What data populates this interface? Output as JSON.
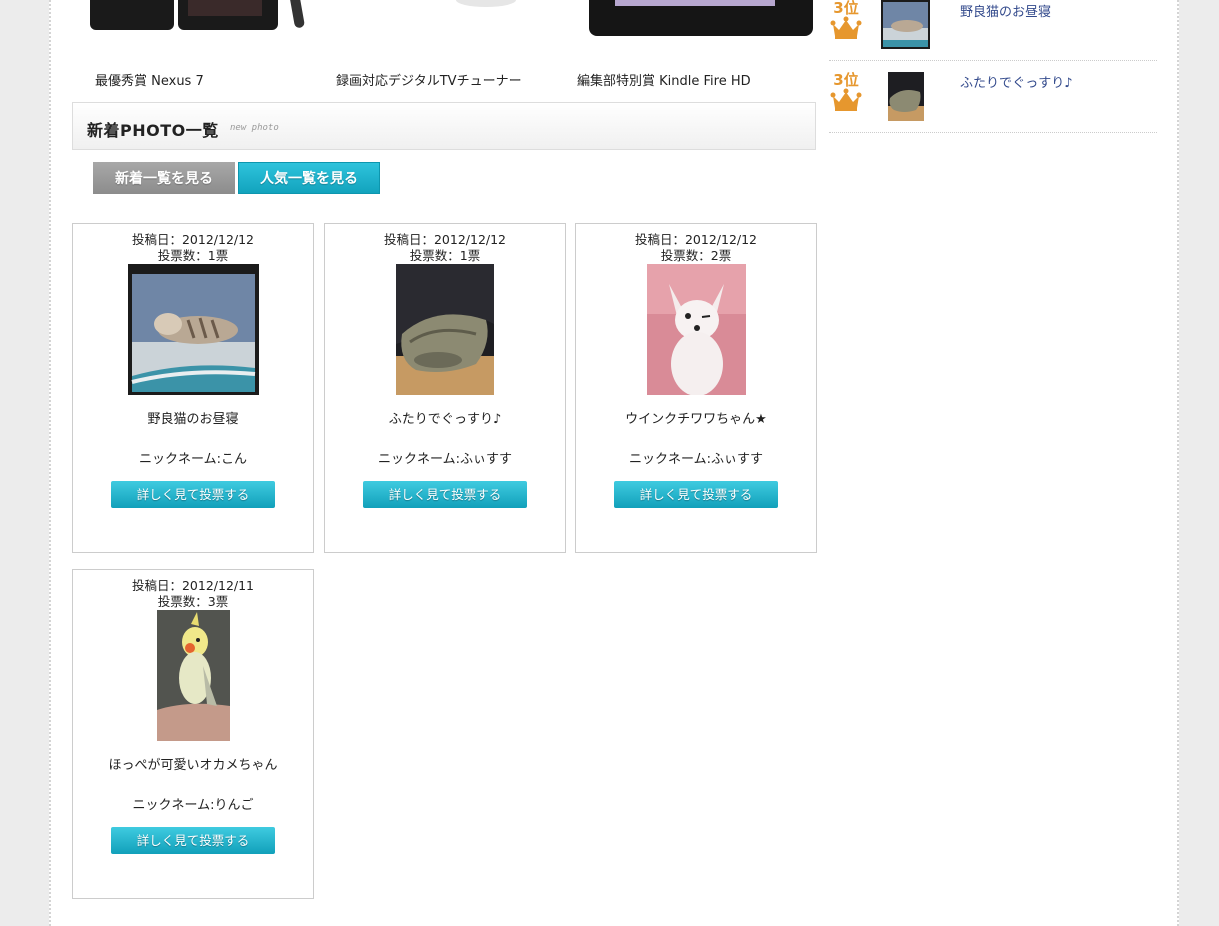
{
  "prizes": [
    {
      "caption": "最優秀賞 Nexus 7"
    },
    {
      "caption": "録画対応デジタルTVチューナー"
    },
    {
      "caption": "編集部特別賞 Kindle Fire HD"
    }
  ],
  "section": {
    "title": "新着PHOTO一覧",
    "subtitle": "new photo"
  },
  "tabs": {
    "new_label": "新着一覧を見る",
    "popular_label": "人気一覧を見る"
  },
  "photos": [
    {
      "date": "投稿日：2012/12/12",
      "votes": "投票数：1票",
      "title": "野良猫のお昼寝",
      "nickname": "ニックネーム:こん",
      "button": "詳しく見て投票する"
    },
    {
      "date": "投稿日：2012/12/12",
      "votes": "投票数：1票",
      "title": "ふたりでぐっすり♪",
      "nickname": "ニックネーム:ふぃすす",
      "button": "詳しく見て投票する"
    },
    {
      "date": "投稿日：2012/12/12",
      "votes": "投票数：2票",
      "title": "ウインクチワワちゃん★",
      "nickname": "ニックネーム:ふぃすす",
      "button": "詳しく見て投票する"
    },
    {
      "date": "投稿日：2012/12/11",
      "votes": "投票数：3票",
      "title": "ほっぺが可愛いオカメちゃん",
      "nickname": "ニックネーム:りんご",
      "button": "詳しく見て投票する"
    }
  ],
  "ranking": [
    {
      "rank": "3位",
      "title": "野良猫のお昼寝"
    },
    {
      "rank": "3位",
      "title": "ふたりでぐっすり♪"
    }
  ],
  "colors": {
    "accent": "#12a3bd",
    "rank": "#e6972e",
    "link": "#334a8c"
  }
}
